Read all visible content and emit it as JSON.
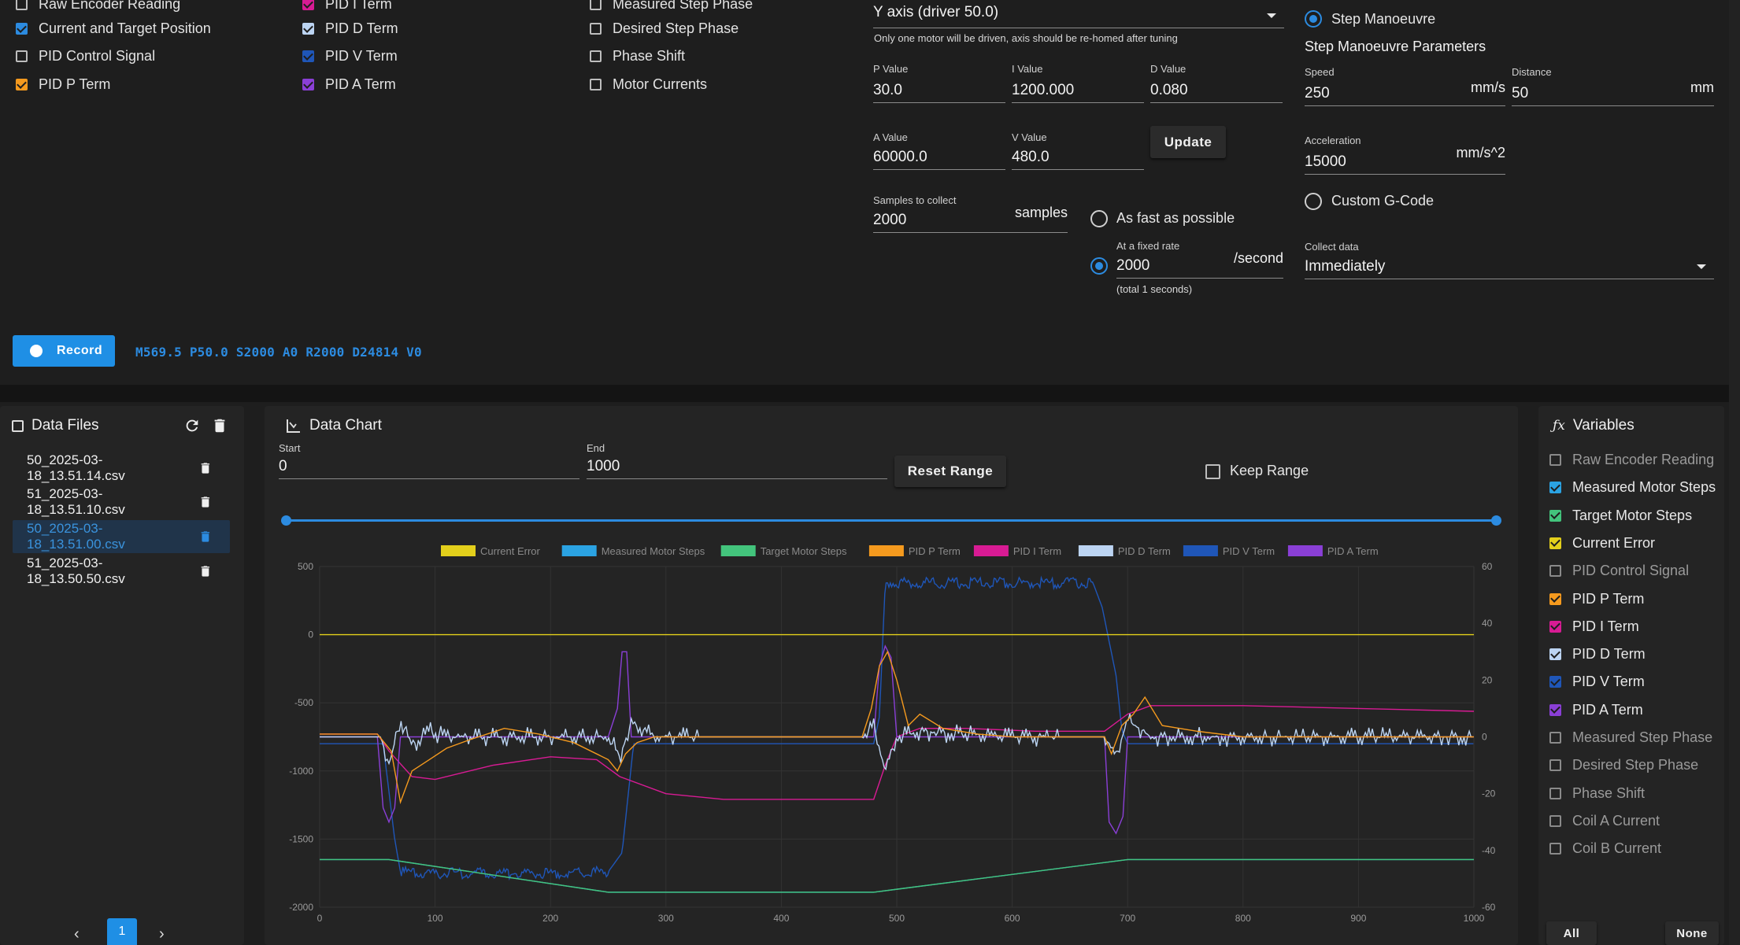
{
  "checkbox_columns": [
    [
      {
        "label": "Raw Encoder Reading",
        "checked": false,
        "color": ""
      },
      {
        "label": "Current and Target Position",
        "checked": true,
        "color": "#2c8be0"
      },
      {
        "label": "PID Control Signal",
        "checked": false,
        "color": ""
      },
      {
        "label": "PID P Term",
        "checked": true,
        "color": "#f59a1e"
      }
    ],
    [
      {
        "label": "PID I Term",
        "checked": true,
        "color": "#d81b94"
      },
      {
        "label": "PID D Term",
        "checked": true,
        "color": "#bcd4f2"
      },
      {
        "label": "PID V Term",
        "checked": true,
        "color": "#1f56b8"
      },
      {
        "label": "PID A Term",
        "checked": true,
        "color": "#8a3fd6"
      }
    ],
    [
      {
        "label": "Measured Step Phase",
        "checked": false,
        "color": ""
      },
      {
        "label": "Desired Step Phase",
        "checked": false,
        "color": ""
      },
      {
        "label": "Phase Shift",
        "checked": false,
        "color": ""
      },
      {
        "label": "Motor Currents",
        "checked": false,
        "color": ""
      }
    ]
  ],
  "axis_select": {
    "value": "Y axis (driver 50.0)",
    "hint": "Only one motor will be driven, axis should be re-homed after tuning"
  },
  "pid": {
    "p_label": "P Value",
    "p_value": "30.0",
    "i_label": "I Value",
    "i_value": "1200.000",
    "d_label": "D Value",
    "d_value": "0.080",
    "a_label": "A Value",
    "a_value": "60000.0",
    "v_label": "V Value",
    "v_value": "480.0",
    "update_label": "Update"
  },
  "samples": {
    "label": "Samples to collect",
    "value": "2000",
    "unit": "samples"
  },
  "rate": {
    "fast_label": "As fast as possible",
    "fixed_label": "At a fixed rate",
    "fixed_value": "2000",
    "fixed_unit": "/second",
    "total_note": "(total 1 seconds)"
  },
  "manoeuvre": {
    "step_label": "Step Manoeuvre",
    "params_title": "Step Manoeuvre Parameters",
    "speed_label": "Speed",
    "speed_value": "250",
    "speed_unit": "mm/s",
    "distance_label": "Distance",
    "distance_value": "50",
    "distance_unit": "mm",
    "accel_label": "Acceleration",
    "accel_value": "15000",
    "accel_unit": "mm/s^2",
    "custom_label": "Custom G-Code",
    "collect_label": "Collect data",
    "collect_value": "Immediately"
  },
  "record": {
    "label": "Record",
    "gcode": "M569.5 P50.0 S2000 A0 R2000 D24814 V0"
  },
  "data_files": {
    "title": "Data Files",
    "files": [
      {
        "name": "50_2025-03-18_13.51.14.csv",
        "selected": false
      },
      {
        "name": "51_2025-03-18_13.51.10.csv",
        "selected": false
      },
      {
        "name": "50_2025-03-18_13.51.00.csv",
        "selected": true
      },
      {
        "name": "51_2025-03-18_13.50.50.csv",
        "selected": false
      }
    ],
    "page": "1"
  },
  "chart_panel": {
    "title": "Data Chart",
    "start_label": "Start",
    "start_value": "0",
    "end_label": "End",
    "end_value": "1000",
    "reset_label": "Reset Range",
    "keep_label": "Keep Range"
  },
  "variables": {
    "title": "Variables",
    "items": [
      {
        "label": "Raw Encoder Reading",
        "checked": false,
        "color": ""
      },
      {
        "label": "Measured Motor Steps",
        "checked": true,
        "color": "#2ba3e3"
      },
      {
        "label": "Target Motor Steps",
        "checked": true,
        "color": "#43c47c"
      },
      {
        "label": "Current Error",
        "checked": true,
        "color": "#e3cf1b"
      },
      {
        "label": "PID Control Signal",
        "checked": false,
        "color": ""
      },
      {
        "label": "PID P Term",
        "checked": true,
        "color": "#f59a1e"
      },
      {
        "label": "PID I Term",
        "checked": true,
        "color": "#d81b94"
      },
      {
        "label": "PID D Term",
        "checked": true,
        "color": "#bcd4f2"
      },
      {
        "label": "PID V Term",
        "checked": true,
        "color": "#1f56b8"
      },
      {
        "label": "PID A Term",
        "checked": true,
        "color": "#8a3fd6"
      },
      {
        "label": "Measured Step Phase",
        "checked": false,
        "color": ""
      },
      {
        "label": "Desired Step Phase",
        "checked": false,
        "color": ""
      },
      {
        "label": "Phase Shift",
        "checked": false,
        "color": ""
      },
      {
        "label": "Coil A Current",
        "checked": false,
        "color": ""
      },
      {
        "label": "Coil B Current",
        "checked": false,
        "color": ""
      }
    ],
    "all_label": "All",
    "none_label": "None"
  },
  "chart_data": {
    "type": "line",
    "xlim": [
      0,
      1000
    ],
    "xticks": [
      0,
      100,
      200,
      300,
      400,
      500,
      600,
      700,
      800,
      900,
      1000
    ],
    "y_left_lim": [
      -2000,
      500
    ],
    "y_left_ticks": [
      500,
      0,
      -500,
      -1000,
      -1500,
      -2000
    ],
    "y_right_lim": [
      -60,
      60
    ],
    "y_right_ticks": [
      60,
      40,
      20,
      0,
      -20,
      -40,
      -60
    ],
    "grid": true,
    "legend_position": "top",
    "series": [
      {
        "name": "Current Error",
        "color": "#e3cf1b",
        "axis": "left",
        "x": [
          0,
          1000
        ],
        "y": [
          0,
          0
        ]
      },
      {
        "name": "Measured Motor Steps",
        "color": "#2ba3e3",
        "axis": "left",
        "x": [
          0,
          60,
          250,
          480,
          700,
          1000
        ],
        "y": [
          -1650,
          -1650,
          -1890,
          -1890,
          -1650,
          -1650
        ]
      },
      {
        "name": "Target Motor Steps",
        "color": "#43c47c",
        "axis": "left",
        "x": [
          0,
          60,
          250,
          480,
          700,
          1000
        ],
        "y": [
          -1650,
          -1650,
          -1890,
          -1890,
          -1650,
          -1650
        ]
      },
      {
        "name": "PID P Term",
        "color": "#f59a1e",
        "axis": "right",
        "x": [
          0,
          50,
          62,
          70,
          80,
          95,
          110,
          130,
          160,
          190,
          220,
          250,
          258,
          265,
          275,
          290,
          320,
          400,
          470,
          478,
          485,
          492,
          500,
          510,
          520,
          540,
          570,
          600,
          640,
          680,
          686,
          695,
          705,
          715,
          730,
          760,
          800,
          900,
          1000
        ],
        "y": [
          1,
          1,
          -5,
          -23,
          -12,
          -8,
          -4,
          -1,
          3,
          1,
          -2,
          -8,
          -12,
          -6,
          -2,
          0,
          0,
          0,
          0,
          10,
          25,
          30,
          20,
          4,
          8,
          3,
          1,
          0,
          0,
          0,
          -6,
          4,
          8,
          14,
          4,
          2,
          0,
          0,
          0
        ]
      },
      {
        "name": "PID I Term",
        "color": "#d81b94",
        "axis": "right",
        "x": [
          0,
          50,
          60,
          80,
          100,
          150,
          200,
          240,
          260,
          300,
          350,
          400,
          480,
          490,
          500,
          520,
          560,
          620,
          680,
          700,
          720,
          800,
          900,
          1000
        ],
        "y": [
          1,
          1,
          -5,
          -14,
          -15,
          -10,
          -7,
          -8,
          -14,
          -20,
          -22,
          -22,
          -22,
          -10,
          0,
          3,
          3,
          2,
          2,
          8,
          11,
          11,
          10,
          9
        ]
      },
      {
        "name": "PID D Term",
        "color": "#bcd4f2",
        "axis": "right",
        "noise": "high",
        "x": [
          0,
          53,
          60,
          70,
          80,
          95,
          110,
          140,
          200,
          250,
          260,
          270,
          290,
          340,
          400,
          470,
          480,
          490,
          500,
          520,
          600,
          680,
          690,
          700,
          720,
          760,
          860,
          1000
        ],
        "y": [
          0,
          0,
          -10,
          6,
          -3,
          2,
          0,
          0,
          0,
          0,
          -7,
          5,
          0,
          0,
          0,
          0,
          4,
          -12,
          0,
          2,
          0,
          0,
          -7,
          6,
          0,
          0,
          0,
          0
        ]
      },
      {
        "name": "PID V Term",
        "color": "#1f56b8",
        "axis": "left",
        "x": [
          0,
          55,
          65,
          70,
          80,
          200,
          250,
          262,
          272,
          480,
          485,
          490,
          500,
          670,
          678,
          690,
          695,
          700,
          1000
        ],
        "y": [
          -800,
          -800,
          -1500,
          -1740,
          -1750,
          -1750,
          -1740,
          -1600,
          -800,
          -800,
          -600,
          380,
          380,
          380,
          200,
          -300,
          -700,
          -800,
          -800
        ]
      },
      {
        "name": "PID A Term",
        "color": "#8a3fd6",
        "axis": "right",
        "x": [
          0,
          50,
          55,
          60,
          65,
          70,
          250,
          258,
          262,
          266,
          270,
          480,
          485,
          490,
          495,
          500,
          680,
          684,
          690,
          696,
          700,
          1000
        ],
        "y": [
          0,
          0,
          -25,
          -30,
          -25,
          0,
          0,
          10,
          30,
          30,
          0,
          0,
          25,
          32,
          28,
          0,
          0,
          -30,
          -34,
          -28,
          0,
          0
        ]
      }
    ]
  }
}
